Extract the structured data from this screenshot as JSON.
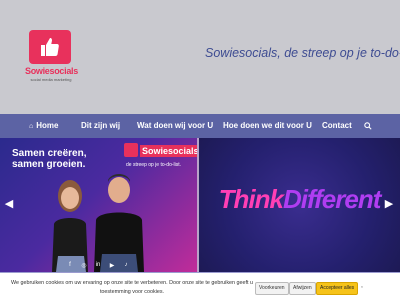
{
  "header": {
    "logo_name": "Sowiesocials",
    "logo_subtitle": "social media marketing",
    "tagline": "Sowiesocials, de streep op je to-do-list"
  },
  "nav": {
    "items": [
      {
        "label": "Home",
        "icon": "home-icon"
      },
      {
        "label": "Dit zijn wij"
      },
      {
        "label": "Wat doen wij voor U"
      },
      {
        "label": "Hoe doen we dit voor U"
      },
      {
        "label": "Contact"
      }
    ],
    "search_icon": "search-icon"
  },
  "slider": {
    "slide1": {
      "heading": "Samen creëren,\nsamen groeien.",
      "logo_name": "Sowiesocials",
      "tagline": "de streep op je to-do-list."
    },
    "slide2": {
      "text_part1": "Think",
      "text_part2": "Different"
    },
    "prev_icon": "chevron-left-icon",
    "next_icon": "chevron-right-icon"
  },
  "cookie": {
    "text": "We gebruiken cookies om uw ervaring op onze site te verbeteren. Door onze site te gebruiken geeft u toestemming voor cookies.",
    "preferences_label": "Voorkeuren",
    "reject_label": "Afwijzen",
    "accept_label": "Accepteer alles"
  },
  "colors": {
    "brand": "#e8315c",
    "nav": "#5c63a4",
    "tagline": "#3e4c92",
    "accept": "#f6c31a"
  }
}
